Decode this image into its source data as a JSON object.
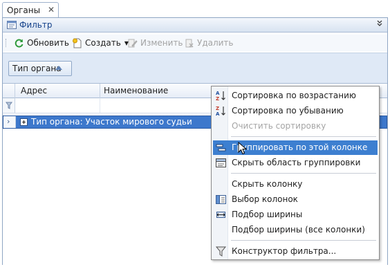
{
  "tab": {
    "title": "Органы",
    "close": "✕"
  },
  "filter_panel": {
    "label": "Фильтр",
    "collapse_glyph": "»"
  },
  "toolbar": {
    "refresh": "Обновить",
    "create": "Создать",
    "edit": "Изменить",
    "delete": "Удалить"
  },
  "group_panel": {
    "chip_label": "Тип органа"
  },
  "grid": {
    "columns": [
      "Адрес",
      "Наименование"
    ],
    "group_row": "Тип органа: Участок мирового судьи",
    "row_arrow": "›"
  },
  "context_menu": {
    "items": [
      {
        "label": "Сортировка по возрастанию",
        "icon": "sort-ascending-icon",
        "state": "normal"
      },
      {
        "label": "Сортировка по убыванию",
        "icon": "sort-descending-icon",
        "state": "normal"
      },
      {
        "label": "Очистить сортировку",
        "icon": "",
        "state": "disabled"
      },
      {
        "label": "Группировать по этой колонке",
        "icon": "group-by-column-icon",
        "state": "selected"
      },
      {
        "label": "Скрыть область группировки",
        "icon": "group-panel-icon",
        "state": "normal"
      },
      {
        "label": "Скрыть колонку",
        "icon": "",
        "state": "normal"
      },
      {
        "label": "Выбор колонок",
        "icon": "column-chooser-icon",
        "state": "normal"
      },
      {
        "label": "Подбор ширины",
        "icon": "best-fit-icon",
        "state": "normal"
      },
      {
        "label": "Подбор ширины (все колонки)",
        "icon": "",
        "state": "normal"
      },
      {
        "label": "Конструктор фильтра...",
        "icon": "filter-editor-icon",
        "state": "normal"
      }
    ]
  },
  "colors": {
    "selection": "#3d7fd0",
    "group_row": "#3d78cc",
    "header_text": "#15428b",
    "disabled_text": "#a5a5a5"
  }
}
